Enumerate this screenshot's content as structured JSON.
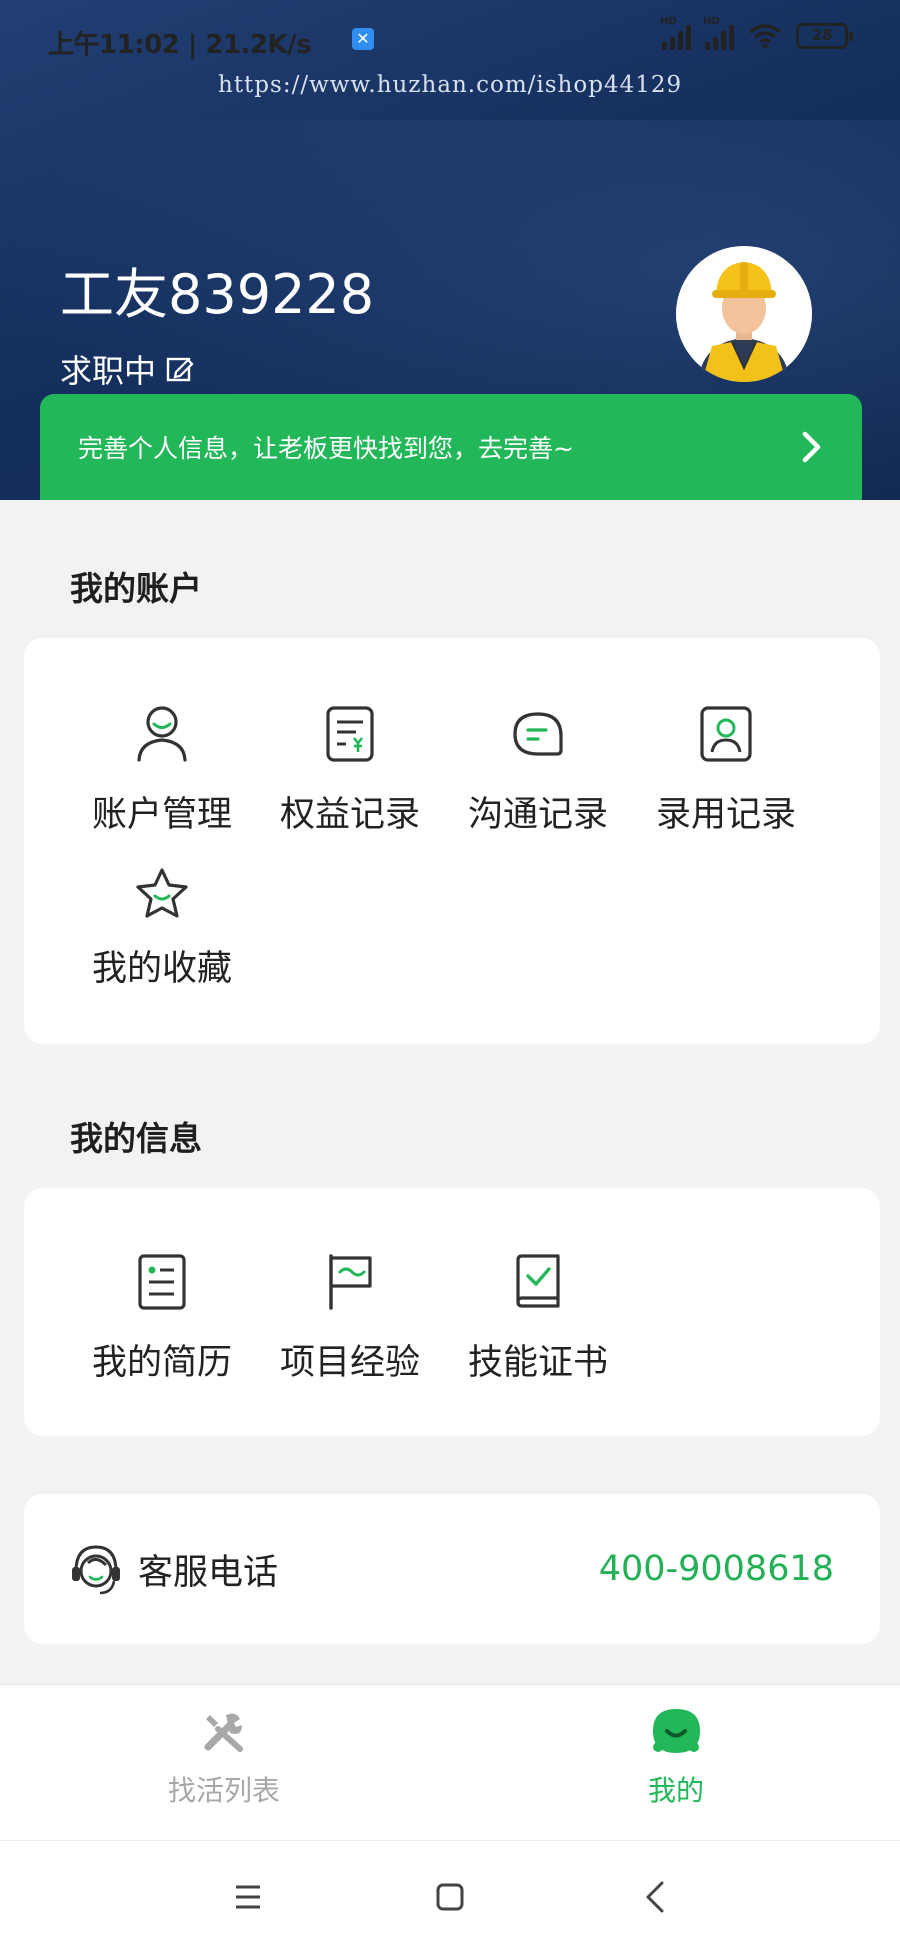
{
  "status_bar": {
    "time": "上午11:02 | 21.2K/s",
    "battery": "28",
    "signal_label": "HD"
  },
  "watermark": "https://www.huzhan.com/ishop44129",
  "profile": {
    "name": "工友839228",
    "status": "求职中"
  },
  "banner": {
    "text": "完善个人信息，让老板更快找到您，去完善~"
  },
  "account": {
    "title": "我的账户",
    "items": [
      {
        "label": "账户管理",
        "icon": "user-icon"
      },
      {
        "label": "权益记录",
        "icon": "bill-icon"
      },
      {
        "label": "沟通记录",
        "icon": "chat-icon"
      },
      {
        "label": "录用记录",
        "icon": "id-card-icon"
      },
      {
        "label": "我的收藏",
        "icon": "star-icon"
      }
    ]
  },
  "info": {
    "title": "我的信息",
    "items": [
      {
        "label": "我的简历",
        "icon": "resume-icon"
      },
      {
        "label": "项目经验",
        "icon": "flag-icon"
      },
      {
        "label": "技能证书",
        "icon": "certificate-icon"
      }
    ]
  },
  "service": {
    "label": "客服电话",
    "phone": "400-9008618"
  },
  "tabbar": {
    "tabs": [
      {
        "label": "找活列表",
        "active": false
      },
      {
        "label": "我的",
        "active": true
      }
    ]
  },
  "colors": {
    "accent": "#22b859",
    "hero": "#1a3566",
    "tab_inactive": "#a8a8a8"
  }
}
